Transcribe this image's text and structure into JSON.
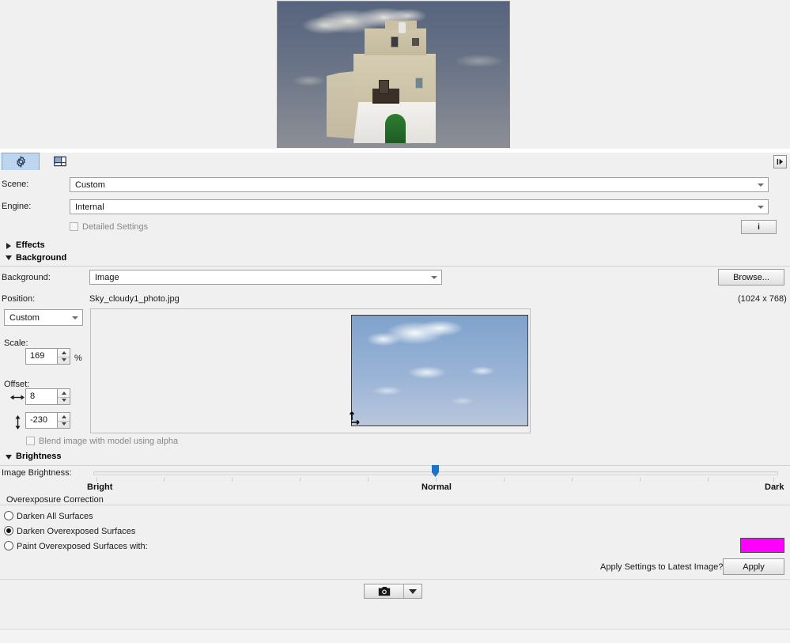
{
  "tabs": [
    {
      "name": "render-settings",
      "icon": "gear-icon",
      "active": true
    },
    {
      "name": "layout-settings",
      "icon": "panel-layout-icon",
      "active": false
    }
  ],
  "panel_expand": {
    "icon": "expand-panel-icon"
  },
  "render_preview": {
    "alt": "3d-building-render"
  },
  "settings": {
    "scene_label": "Scene:",
    "scene_value": "Custom",
    "engine_label": "Engine:",
    "engine_value": "Internal",
    "detailed_settings_label": "Detailed Settings",
    "detailed_settings_checked": false,
    "info_button_label": "i"
  },
  "sections": {
    "effects": {
      "label": "Effects",
      "expanded": false
    },
    "background": {
      "label": "Background",
      "expanded": true
    },
    "brightness": {
      "label": "Brightness",
      "expanded": true
    }
  },
  "background": {
    "label": "Background:",
    "value": "Image",
    "browse_label": "Browse...",
    "file_name": "Sky_cloudy1_photo.jpg",
    "dimensions": "(1024 x 768)",
    "position_label": "Position:",
    "position_value": "Custom",
    "scale_label": "Scale:",
    "scale_value": "169",
    "scale_unit": "%",
    "offset_label": "Offset:",
    "offset_x_value": "8",
    "offset_y_value": "-230",
    "offset_x_icon": "horizontal-arrows-icon",
    "offset_y_icon": "vertical-arrows-icon",
    "blend_label": "Blend image with model using alpha",
    "blend_checked": false,
    "preview_alt": "sky-clouds-preview"
  },
  "brightness": {
    "label": "Image Brightness:",
    "left_label": "Bright",
    "center_label": "Normal",
    "right_label": "Dark",
    "value_position_pct": 50,
    "tick_count": 9,
    "overexposure_title": "Overexposure Correction",
    "options": [
      {
        "label": "Darken All Surfaces",
        "selected": false
      },
      {
        "label": "Darken Overexposed Surfaces",
        "selected": true
      },
      {
        "label": "Paint Overexposed Surfaces with:",
        "selected": false
      }
    ],
    "paint_color": "#FF00FF",
    "apply_question": "Apply Settings to Latest Image?",
    "apply_button": "Apply"
  },
  "bottom": {
    "capture_icon": "camera-icon",
    "capture_menu_icon": "chevron-down-icon"
  },
  "colors": {
    "panel_bg": "#f0f0f0",
    "tab_active": "#bcd6ef",
    "slider_thumb": "#1f72c4",
    "paint_color": "#FF00FF"
  }
}
